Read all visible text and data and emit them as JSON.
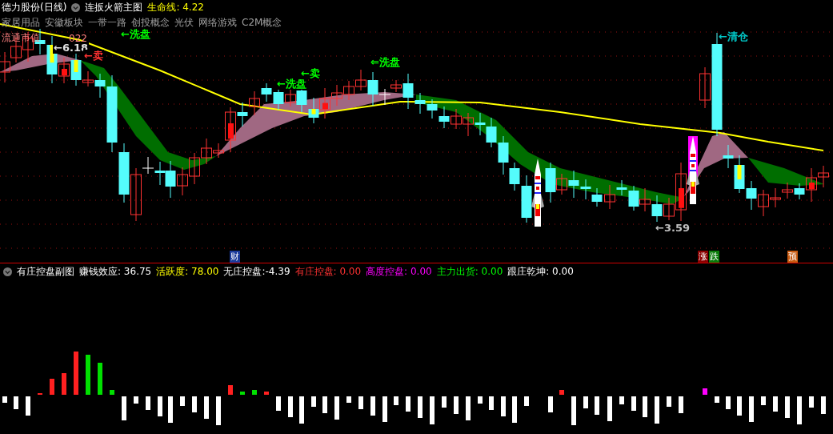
{
  "main_pane": {
    "stock": "德力股份(日线)",
    "indicator": "连扳火箭主图",
    "life_line": "生命线: 4.22",
    "concepts": [
      "家居用品",
      "安徽板块",
      "一带一路",
      "创投概念",
      "光伏",
      "网络游戏",
      "C2M概念"
    ],
    "market_cap_label": "流通市值",
    "market_cap_tail": "022",
    "annotations": [
      {
        "text": "←6.18",
        "color": "#e0e0e0"
      },
      {
        "text": "←洗盘",
        "color": "#00ff00"
      },
      {
        "text": "←卖",
        "color": "#ff3232"
      },
      {
        "text": "←洗盘",
        "color": "#00ff00"
      },
      {
        "text": "←卖",
        "color": "#00ff00"
      },
      {
        "text": "⇐洗盘",
        "color": "#00ff00"
      },
      {
        "text": "←清仓",
        "color": "#00c8c8"
      },
      {
        "text": "←3.59",
        "color": "#c0c0c0"
      }
    ],
    "markers": [
      {
        "text": "财",
        "kind": "finance"
      },
      {
        "text": "涨",
        "kind": "rise"
      },
      {
        "text": "跌",
        "kind": "fall"
      },
      {
        "text": "预",
        "kind": "forecast"
      }
    ]
  },
  "sub_pane": {
    "indicator": "有庄控盘副图",
    "readings": [
      {
        "text": "赚钱效应: 36.75",
        "color": "#ffffff"
      },
      {
        "text": "活跃度: 78.00",
        "color": "#ffff00"
      },
      {
        "text": "无庄控盘:-4.39",
        "color": "#ffffff"
      },
      {
        "text": "有庄控盘: 0.00",
        "color": "#ff3232"
      },
      {
        "text": "高度控盘: 0.00",
        "color": "#ff00ff"
      },
      {
        "text": "主力出货: 0.00",
        "color": "#00ff00"
      },
      {
        "text": "跟庄乾坤: 0.00",
        "color": "#ffffff"
      }
    ]
  }
}
